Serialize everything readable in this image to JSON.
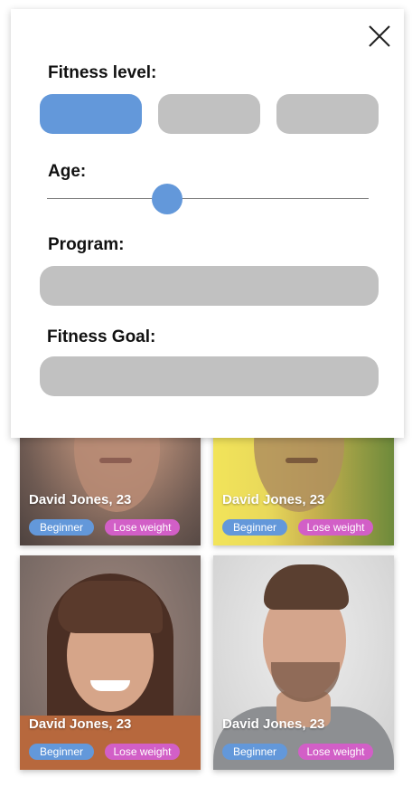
{
  "colors": {
    "accent": "#6398da",
    "goal_tag": "#d25fc7",
    "placeholder": "#c1c1c1"
  },
  "filter": {
    "close_icon": "close-icon",
    "fitness_level_label": "Fitness level:",
    "age_label": "Age:",
    "age_value_fraction": 0.37,
    "program_label": "Program:",
    "fitness_goal_label": "Fitness Goal:"
  },
  "profiles": [
    {
      "name": "David Jones, 23",
      "level": "Beginner",
      "goal": "Lose weight"
    },
    {
      "name": "David Jones, 23",
      "level": "Beginner",
      "goal": "Lose weight"
    },
    {
      "name": "David Jones, 23",
      "level": "Beginner",
      "goal": "Lose weight"
    },
    {
      "name": "David Jones, 23",
      "level": "Beginner",
      "goal": "Lose weight"
    }
  ]
}
